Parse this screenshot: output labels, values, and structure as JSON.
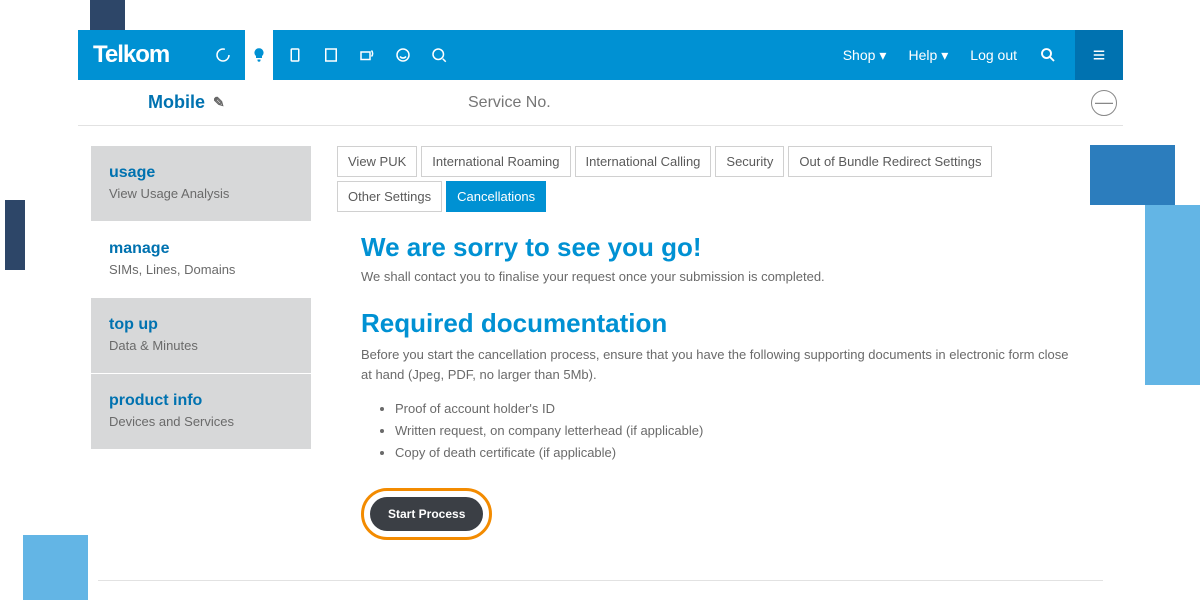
{
  "brand": "Telkom",
  "navmenu": {
    "shop": "Shop",
    "help": "Help",
    "logout": "Log out"
  },
  "subbar": {
    "mobile": "Mobile",
    "service": "Service No."
  },
  "sidebar": [
    {
      "title": "usage",
      "sub": "View Usage Analysis"
    },
    {
      "title": "manage",
      "sub": "SIMs, Lines, Domains"
    },
    {
      "title": "top up",
      "sub": "Data & Minutes"
    },
    {
      "title": "product info",
      "sub": "Devices and Services"
    }
  ],
  "tabs": [
    "View PUK",
    "International Roaming",
    "International Calling",
    "Security",
    "Out of Bundle Redirect Settings",
    "Other Settings",
    "Cancellations"
  ],
  "activeTab": "Cancellations",
  "content": {
    "h1": "We are sorry to see you go!",
    "lead": "We shall contact you to finalise your request once your submission is completed.",
    "h2": "Required documentation",
    "p": "Before you start the cancellation process, ensure that you have the following supporting documents in electronic form close at hand (Jpeg, PDF, no larger than 5Mb).",
    "docs": [
      "Proof of account holder's ID",
      "Written request, on company letterhead (if applicable)",
      "Copy of death certificate (if applicable)"
    ],
    "button": "Start Process"
  }
}
